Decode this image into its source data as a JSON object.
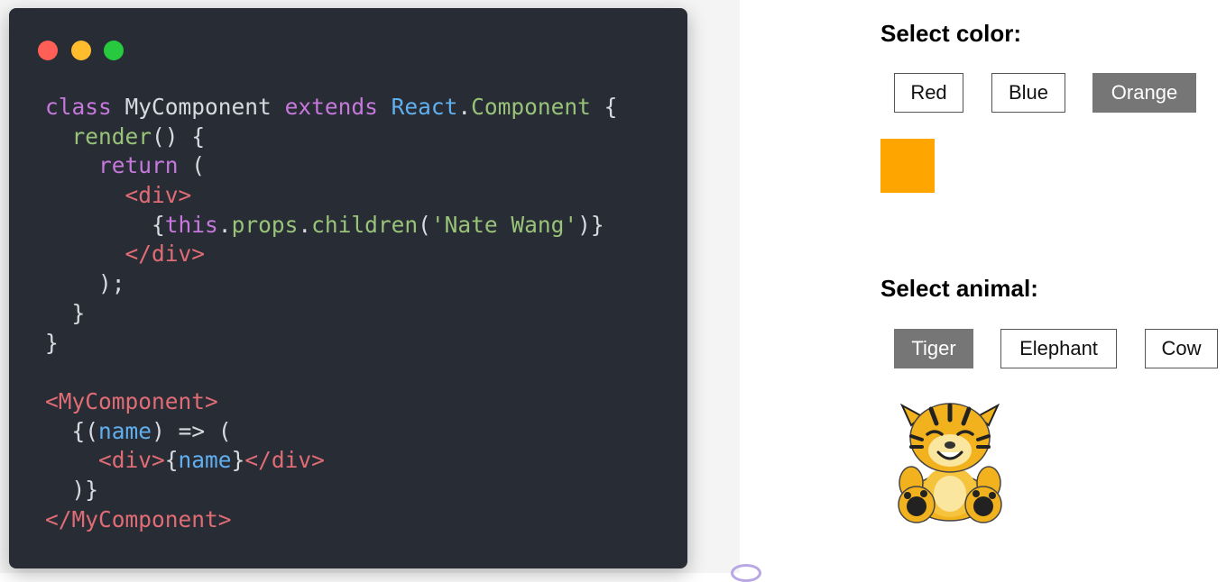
{
  "colors": {
    "selected_bg": "#767676",
    "editor_bg": "#282c34",
    "swatch": "#ffa500",
    "dot_red": "#ff5f56",
    "dot_yellow": "#ffbd2e",
    "dot_green": "#27c93f"
  },
  "code": {
    "lines": [
      "class MyComponent extends React.Component {",
      "  render() {",
      "    return (",
      "      <div>",
      "        {this.props.children('Nate Wang')}",
      "      </div>",
      "    );",
      "  }",
      "}",
      "",
      "<MyComponent>",
      "  {(name) => (",
      "    <div>{name}</div>",
      "  )}",
      "</MyComponent>"
    ]
  },
  "color_panel": {
    "title": "Select color:",
    "options": [
      "Red",
      "Blue",
      "Orange"
    ],
    "selected": "Orange"
  },
  "animal_panel": {
    "title": "Select animal:",
    "options": [
      "Tiger",
      "Elephant",
      "Cow"
    ],
    "selected": "Tiger",
    "image_icon": "tiger-plush-icon"
  }
}
